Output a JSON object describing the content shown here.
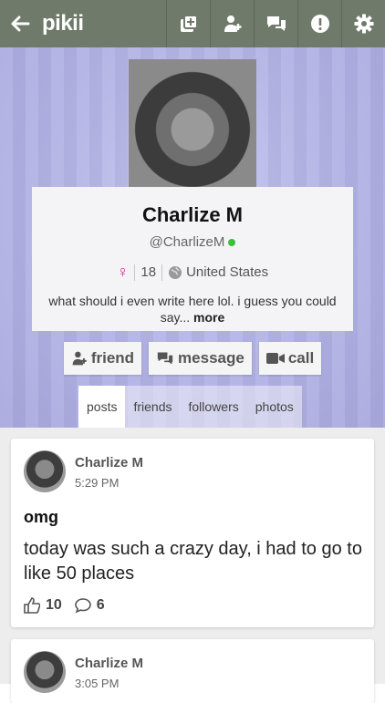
{
  "app": {
    "logo": "pikii"
  },
  "topbar": {
    "icons": [
      "back-arrow-icon",
      "add-post-icon",
      "add-user-icon",
      "chat-icon",
      "alert-icon",
      "gear-icon"
    ]
  },
  "profile": {
    "name": "Charlize M",
    "handle": "@CharlizeM",
    "online_color": "#3bc03b",
    "gender_symbol": "♀",
    "age": "18",
    "location": "United States",
    "bio": "what should i even write here lol. i guess you could say...",
    "bio_more": "more"
  },
  "actions": {
    "friend": "friend",
    "message": "message",
    "call": "call"
  },
  "tabs": [
    "posts",
    "friends",
    "followers",
    "photos"
  ],
  "posts": [
    {
      "author": "Charlize M",
      "time": "5:29 PM",
      "title": "omg",
      "body": "today was such a crazy day, i had to go to like 50 places",
      "likes": "10",
      "comments": "6"
    },
    {
      "author": "Charlize M",
      "time": "3:05 PM"
    }
  ],
  "colors": {
    "topbar": "#6f7a6a",
    "hero": "#b5b5e7",
    "gender": "#cc2fa0"
  }
}
